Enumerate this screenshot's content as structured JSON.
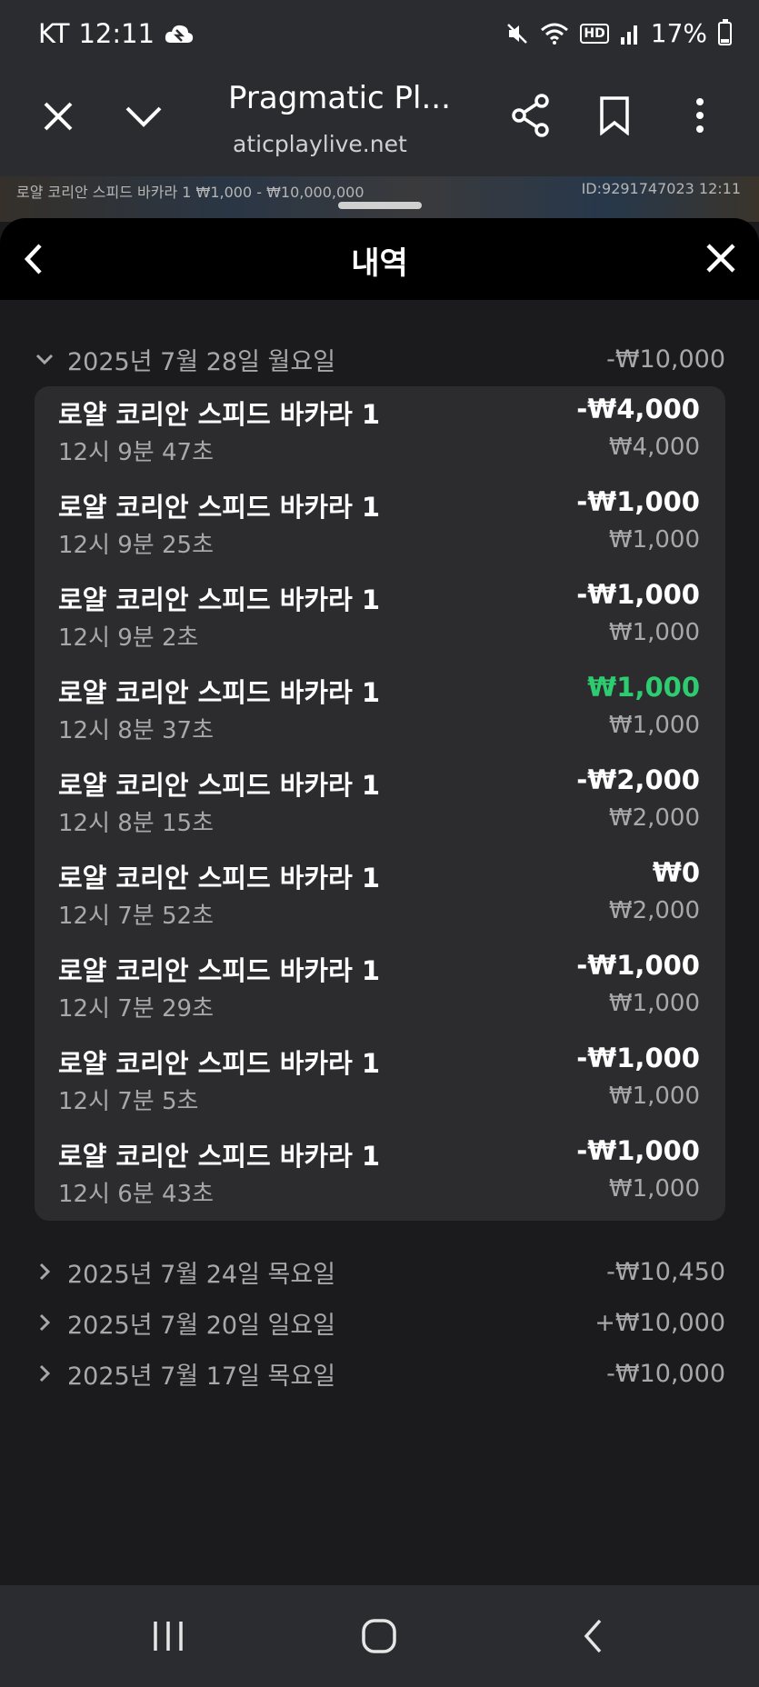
{
  "status_bar": {
    "carrier": "KT",
    "time": "12:11",
    "hd": "HD",
    "battery": "17%",
    "icons": [
      "cloud-icon",
      "mute-icon",
      "wifi-icon",
      "hd-icon",
      "signal-icon",
      "battery-icon"
    ]
  },
  "browser": {
    "title": "Pragmatic Pl...",
    "url": "aticplaylive.net",
    "icons": [
      "close-icon",
      "chevron-down-icon",
      "share-icon",
      "bookmark-icon",
      "more-icon"
    ]
  },
  "game_strip": {
    "info": "로얄 코리안 스피드 바카라 1 ₩1,000 - ₩10,000,000",
    "id": "ID:9291747023 12:11"
  },
  "panel": {
    "title": "내역"
  },
  "expanded_day": {
    "label": "2025년 7월 28일 월요일",
    "total": "-₩10,000",
    "entries": [
      {
        "name": "로얄 코리안 스피드 바카라 1",
        "time": "12시 9분 47초",
        "amount": "-₩4,000",
        "bet": "₩4,000"
      },
      {
        "name": "로얄 코리안 스피드 바카라 1",
        "time": "12시 9분 25초",
        "amount": "-₩1,000",
        "bet": "₩1,000"
      },
      {
        "name": "로얄 코리안 스피드 바카라 1",
        "time": "12시 9분 2초",
        "amount": "-₩1,000",
        "bet": "₩1,000"
      },
      {
        "name": "로얄 코리안 스피드 바카라 1",
        "time": "12시 8분 37초",
        "amount": "₩1,000",
        "bet": "₩1,000"
      },
      {
        "name": "로얄 코리안 스피드 바카라 1",
        "time": "12시 8분 15초",
        "amount": "-₩2,000",
        "bet": "₩2,000"
      },
      {
        "name": "로얄 코리안 스피드 바카라 1",
        "time": "12시 7분 52초",
        "amount": "₩0",
        "bet": "₩2,000"
      },
      {
        "name": "로얄 코리안 스피드 바카라 1",
        "time": "12시 7분 29초",
        "amount": "-₩1,000",
        "bet": "₩1,000"
      },
      {
        "name": "로얄 코리안 스피드 바카라 1",
        "time": "12시 7분 5초",
        "amount": "-₩1,000",
        "bet": "₩1,000"
      },
      {
        "name": "로얄 코리안 스피드 바카라 1",
        "time": "12시 6분 43초",
        "amount": "-₩1,000",
        "bet": "₩1,000"
      }
    ]
  },
  "collapsed_days": [
    {
      "label": "2025년 7월 24일 목요일",
      "total": "-₩10,450"
    },
    {
      "label": "2025년 7월 20일 일요일",
      "total": "+₩10,000"
    },
    {
      "label": "2025년 7월 17일 목요일",
      "total": "-₩10,000"
    }
  ],
  "colors": {
    "win": "#2ecc71",
    "background": "#1b1b1d",
    "card": "#2c2c2e"
  }
}
